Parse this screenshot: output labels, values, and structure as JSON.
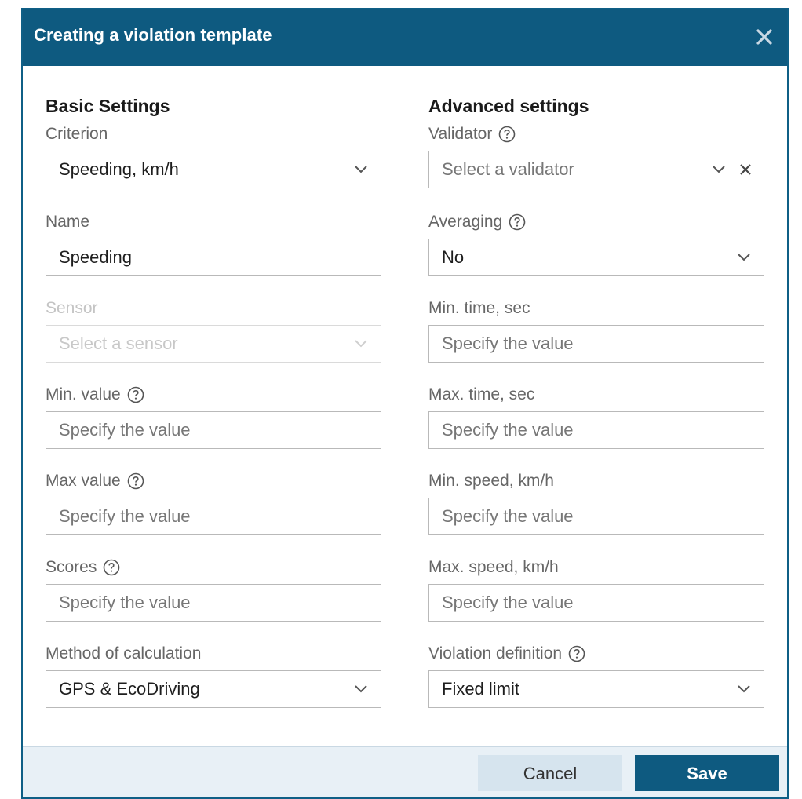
{
  "dialog": {
    "title": "Creating a violation template"
  },
  "basic": {
    "section_title": "Basic Settings",
    "criterion": {
      "label": "Criterion",
      "value": "Speeding, km/h"
    },
    "name": {
      "label": "Name",
      "value": "Speeding"
    },
    "sensor": {
      "label": "Sensor",
      "placeholder": "Select a sensor",
      "disabled": true
    },
    "min_value": {
      "label": "Min. value",
      "placeholder": "Specify the value"
    },
    "max_value": {
      "label": "Max value",
      "placeholder": "Specify the value"
    },
    "scores": {
      "label": "Scores",
      "placeholder": "Specify the value"
    },
    "method": {
      "label": "Method of calculation",
      "value": "GPS & EcoDriving"
    }
  },
  "advanced": {
    "section_title": "Advanced settings",
    "validator": {
      "label": "Validator",
      "placeholder": "Select a validator"
    },
    "averaging": {
      "label": "Averaging",
      "value": "No"
    },
    "min_time": {
      "label": "Min. time, sec",
      "placeholder": "Specify the value"
    },
    "max_time": {
      "label": "Max. time, sec",
      "placeholder": "Specify the value"
    },
    "min_speed": {
      "label": "Min. speed, km/h",
      "placeholder": "Specify the value"
    },
    "max_speed": {
      "label": "Max. speed, km/h",
      "placeholder": "Specify the value"
    },
    "violation_definition": {
      "label": "Violation definition",
      "value": "Fixed limit"
    }
  },
  "footer": {
    "cancel_label": "Cancel",
    "save_label": "Save"
  },
  "colors": {
    "header": "#0e5a80",
    "save_button": "#0e5a80",
    "cancel_button": "#d6e4ee",
    "footer": "#e8f0f6"
  }
}
